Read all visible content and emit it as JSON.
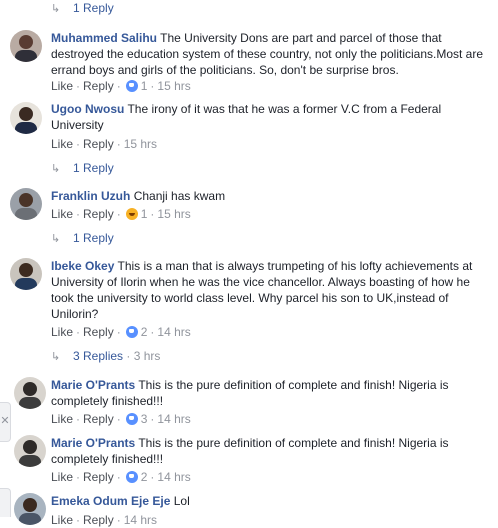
{
  "top_reply": "1 Reply",
  "comments": [
    {
      "author": "Muhammed Salihu",
      "text": "The University Dons are part and parcel of those that destroyed the education system of these country, not only the politicians.Most are errand boys and girls of the politicians. So, don't be surprise bros.",
      "like": "Like",
      "reply": "Reply",
      "reaction_count": "1",
      "time": "15 hrs"
    },
    {
      "author": "Ugoo Nwosu",
      "text": "The irony of it was that he was a former V.C from a Federal University",
      "like": "Like",
      "reply": "Reply",
      "time": "15 hrs",
      "replies": "1 Reply"
    },
    {
      "author": "Franklin Uzuh",
      "text": "Chanji has kwam",
      "like": "Like",
      "reply": "Reply",
      "reaction_count": "1",
      "time": "15 hrs",
      "replies": "1 Reply"
    },
    {
      "author": "Ibeke Okey",
      "text": "This is a man that is always trumpeting of his lofty achievements at University of Ilorin when he was the vice chancellor. Always boasting of how he took the university to world class level. Why parcel his son to UK,instead of Unilorin?",
      "like": "Like",
      "reply": "Reply",
      "reaction_count": "2",
      "time": "14 hrs",
      "replies": "3 Replies",
      "replies_time": "3 hrs"
    },
    {
      "author": "Marie O'Prants",
      "text": "This is the pure definition of complete and finish! Nigeria is completely finished!!!",
      "like": "Like",
      "reply": "Reply",
      "reaction_count": "3",
      "time": "14 hrs"
    },
    {
      "author": "Marie O'Prants",
      "text": "This is the pure definition of complete and finish! Nigeria is completely finished!!!",
      "like": "Like",
      "reply": "Reply",
      "reaction_count": "2",
      "time": "14 hrs"
    },
    {
      "author": "Emeka Odum Eje Eje",
      "text": "Lol",
      "like": "Like",
      "reply": "Reply",
      "time": "14 hrs"
    }
  ],
  "side_tab_icon": "close-icon",
  "colors": {
    "author": "#365899",
    "meta": "#90949c",
    "like_reaction": "#5890ff",
    "haha_reaction": "#f7b125"
  }
}
